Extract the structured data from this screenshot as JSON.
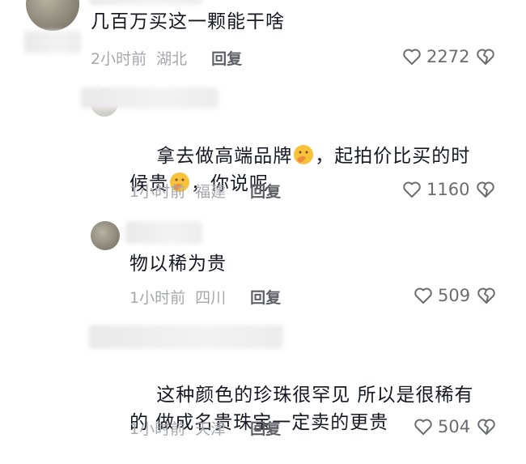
{
  "comments": [
    {
      "text": "几百万买这一颗能干啥",
      "time": "2小时前",
      "location": "湖北",
      "reply": "回复",
      "likes": "2272"
    },
    {
      "text_parts": [
        "拿去做高端品牌",
        "，起拍价比买的时",
        "候贵",
        "，你说呢"
      ],
      "time": "1小时前",
      "location": "福建",
      "reply": "回复",
      "likes": "1160",
      "emoji": "smirk-hand-over-mouth-emoji"
    },
    {
      "text": "物以稀为贵",
      "time": "1小时前",
      "location": "四川",
      "reply": "回复",
      "likes": "509"
    },
    {
      "text_lines": [
        "这种颜色的珍珠很罕见 所以是很稀有",
        "的 做成名贵珠宝一定卖的更贵"
      ],
      "time": "1小时前",
      "location": "天津",
      "reply": "回复",
      "likes": "504"
    }
  ],
  "icons": {
    "like": "heart-outline-icon",
    "dislike": "broken-heart-icon"
  },
  "colors": {
    "text": "#161823",
    "meta": "#a5a7ad",
    "reply": "#5f6068"
  }
}
